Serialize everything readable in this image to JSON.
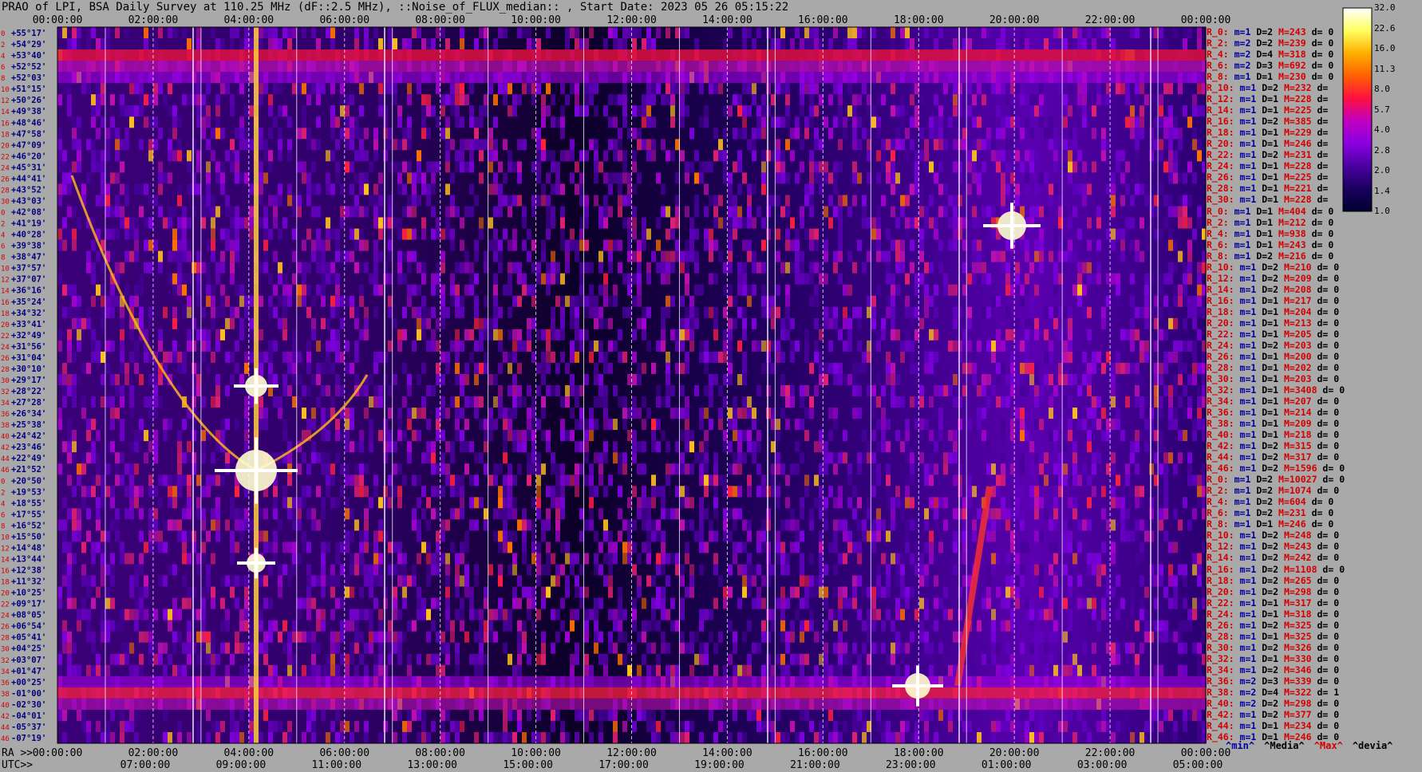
{
  "title": "PRAO of LPI, BSA Daily Survey at 110.25 MHz (dF::2.5 MHz), ::Noise_of_FLUX_median:: , Start Date: 2023 05 26 05:15:22",
  "chart_data": {
    "type": "heatmap",
    "top_ticks": [
      "00:00:00",
      "02:00:00",
      "04:00:00",
      "06:00:00",
      "08:00:00",
      "10:00:00",
      "12:00:00",
      "14:00:00",
      "16:00:00",
      "18:00:00",
      "20:00:00",
      "22:00:00",
      "00:00:00"
    ],
    "ra_prefix": "RA >>",
    "utc_prefix": "UTC>>",
    "bottom_ra_ticks": [
      "00:00:00",
      "02:00:00",
      "04:00:00",
      "06:00:00",
      "08:00:00",
      "10:00:00",
      "12:00:00",
      "14:00:00",
      "16:00:00",
      "18:00:00",
      "20:00:00",
      "22:00:00",
      "00:00:00"
    ],
    "utc_ticks": [
      "07:00:00",
      "09:00:00",
      "11:00:00",
      "13:00:00",
      "15:00:00",
      "17:00:00",
      "19:00:00",
      "21:00:00",
      "23:00:00",
      "01:00:00",
      "03:00:00",
      "05:00:00"
    ],
    "dec_labels": [
      "+55°17'",
      "+54°29'",
      "+53°40'",
      "+52°52'",
      "+52°03'",
      "+51°15'",
      "+50°26'",
      "+49°38'",
      "+48°46'",
      "+47°58'",
      "+47°09'",
      "+46°20'",
      "+45°31'",
      "+44°41'",
      "+43°52'",
      "+43°03'",
      "+42°08'",
      "+41°19'",
      "+40°28'",
      "+39°38'",
      "+38°47'",
      "+37°57'",
      "+37°07'",
      "+36°16'",
      "+35°24'",
      "+34°32'",
      "+33°41'",
      "+32°49'",
      "+31°56'",
      "+31°04'",
      "+30°10'",
      "+29°17'",
      "+28°22'",
      "+27°28'",
      "+26°34'",
      "+25°38'",
      "+24°42'",
      "+23°46'",
      "+22°49'",
      "+21°52'",
      "+20°50'",
      "+19°53'",
      "+18°55'",
      "+17°55'",
      "+16°52'",
      "+15°50'",
      "+14°48'",
      "+13°44'",
      "+12°38'",
      "+11°32'",
      "+10°25'",
      "+09°17'",
      "+08°05'",
      "+06°54'",
      "+05°41'",
      "+04°25'",
      "+03°07'",
      "+01°47'",
      "+00°25'",
      "-01°00'",
      "-02°30'",
      "-04°01'",
      "-05°37'",
      "-07°19'"
    ],
    "row_index": [
      "0",
      "2",
      "4",
      "6",
      "8",
      "10",
      "12",
      "14",
      "16",
      "18",
      "20",
      "22",
      "24",
      "26",
      "28",
      "30",
      "0",
      "2",
      "4",
      "6",
      "8",
      "10",
      "12",
      "14",
      "16",
      "18",
      "20",
      "22",
      "24",
      "26",
      "28",
      "30",
      "32",
      "34",
      "36",
      "38",
      "40",
      "42",
      "44",
      "46",
      "0",
      "2",
      "4",
      "6",
      "8",
      "10",
      "12",
      "14",
      "16",
      "18",
      "20",
      "22",
      "24",
      "26",
      "28",
      "30",
      "32",
      "34",
      "36",
      "38",
      "40",
      "42",
      "44",
      "46"
    ],
    "right_rows": [
      {
        "r": "R_0:",
        "m": "m=1",
        "D": "D=2",
        "M": "M=243",
        "d": "d= 0"
      },
      {
        "r": "R_2:",
        "m": "m=2",
        "D": "D=2",
        "M": "M=239",
        "d": "d= 0"
      },
      {
        "r": "R_4:",
        "m": "m=2",
        "D": "D=4",
        "M": "M=318",
        "d": "d= 0"
      },
      {
        "r": "R_6:",
        "m": "m=2",
        "D": "D=3",
        "M": "M=692",
        "d": "d= 0"
      },
      {
        "r": "R_8:",
        "m": "m=1",
        "D": "D=1",
        "M": "M=230",
        "d": "d= 0"
      },
      {
        "r": "R_10:",
        "m": "m=1",
        "D": "D=2",
        "M": "M=232",
        "d": "d="
      },
      {
        "r": "R_12:",
        "m": "m=1",
        "D": "D=1",
        "M": "M=228",
        "d": "d="
      },
      {
        "r": "R_14:",
        "m": "m=1",
        "D": "D=1",
        "M": "M=225",
        "d": "d="
      },
      {
        "r": "R_16:",
        "m": "m=1",
        "D": "D=2",
        "M": "M=385",
        "d": "d="
      },
      {
        "r": "R_18:",
        "m": "m=1",
        "D": "D=1",
        "M": "M=229",
        "d": "d="
      },
      {
        "r": "R_20:",
        "m": "m=1",
        "D": "D=1",
        "M": "M=246",
        "d": "d="
      },
      {
        "r": "R_22:",
        "m": "m=1",
        "D": "D=2",
        "M": "M=231",
        "d": "d="
      },
      {
        "r": "R_24:",
        "m": "m=1",
        "D": "D=1",
        "M": "M=228",
        "d": "d="
      },
      {
        "r": "R_26:",
        "m": "m=1",
        "D": "D=1",
        "M": "M=225",
        "d": "d="
      },
      {
        "r": "R_28:",
        "m": "m=1",
        "D": "D=1",
        "M": "M=221",
        "d": "d="
      },
      {
        "r": "R_30:",
        "m": "m=1",
        "D": "D=1",
        "M": "M=228",
        "d": "d="
      },
      {
        "r": "R_0:",
        "m": "m=1",
        "D": "D=1",
        "M": "M=404",
        "d": "d= 0"
      },
      {
        "r": "R_2:",
        "m": "m=1",
        "D": "D=1",
        "M": "M=212",
        "d": "d= 0"
      },
      {
        "r": "R_4:",
        "m": "m=1",
        "D": "D=1",
        "M": "M=938",
        "d": "d= 0"
      },
      {
        "r": "R_6:",
        "m": "m=1",
        "D": "D=1",
        "M": "M=243",
        "d": "d= 0"
      },
      {
        "r": "R_8:",
        "m": "m=1",
        "D": "D=2",
        "M": "M=216",
        "d": "d= 0"
      },
      {
        "r": "R_10:",
        "m": "m=1",
        "D": "D=2",
        "M": "M=210",
        "d": "d= 0"
      },
      {
        "r": "R_12:",
        "m": "m=1",
        "D": "D=2",
        "M": "M=209",
        "d": "d= 0"
      },
      {
        "r": "R_14:",
        "m": "m=1",
        "D": "D=2",
        "M": "M=208",
        "d": "d= 0"
      },
      {
        "r": "R_16:",
        "m": "m=1",
        "D": "D=1",
        "M": "M=217",
        "d": "d= 0"
      },
      {
        "r": "R_18:",
        "m": "m=1",
        "D": "D=1",
        "M": "M=204",
        "d": "d= 0"
      },
      {
        "r": "R_20:",
        "m": "m=1",
        "D": "D=1",
        "M": "M=213",
        "d": "d= 0"
      },
      {
        "r": "R_22:",
        "m": "m=1",
        "D": "D=1",
        "M": "M=205",
        "d": "d= 0"
      },
      {
        "r": "R_24:",
        "m": "m=1",
        "D": "D=2",
        "M": "M=203",
        "d": "d= 0"
      },
      {
        "r": "R_26:",
        "m": "m=1",
        "D": "D=1",
        "M": "M=200",
        "d": "d= 0"
      },
      {
        "r": "R_28:",
        "m": "m=1",
        "D": "D=1",
        "M": "M=202",
        "d": "d= 0"
      },
      {
        "r": "R_30:",
        "m": "m=1",
        "D": "D=1",
        "M": "M=203",
        "d": "d= 0"
      },
      {
        "r": "R_32:",
        "m": "m=1",
        "D": "D=1",
        "M": "M=3408",
        "d": "d= 0"
      },
      {
        "r": "R_34:",
        "m": "m=1",
        "D": "D=1",
        "M": "M=207",
        "d": "d= 0"
      },
      {
        "r": "R_36:",
        "m": "m=1",
        "D": "D=1",
        "M": "M=214",
        "d": "d= 0"
      },
      {
        "r": "R_38:",
        "m": "m=1",
        "D": "D=1",
        "M": "M=209",
        "d": "d= 0"
      },
      {
        "r": "R_40:",
        "m": "m=1",
        "D": "D=1",
        "M": "M=218",
        "d": "d= 0"
      },
      {
        "r": "R_42:",
        "m": "m=1",
        "D": "D=2",
        "M": "M=315",
        "d": "d= 0"
      },
      {
        "r": "R_44:",
        "m": "m=1",
        "D": "D=2",
        "M": "M=317",
        "d": "d= 0"
      },
      {
        "r": "R_46:",
        "m": "m=1",
        "D": "D=2",
        "M": "M=1596",
        "d": "d= 0"
      },
      {
        "r": "R_0:",
        "m": "m=1",
        "D": "D=2",
        "M": "M=10027",
        "d": "d= 0"
      },
      {
        "r": "R_2:",
        "m": "m=1",
        "D": "D=2",
        "M": "M=1074",
        "d": "d= 0"
      },
      {
        "r": "R_4:",
        "m": "m=1",
        "D": "D=2",
        "M": "M=604",
        "d": "d= 0"
      },
      {
        "r": "R_6:",
        "m": "m=1",
        "D": "D=2",
        "M": "M=231",
        "d": "d= 0"
      },
      {
        "r": "R_8:",
        "m": "m=1",
        "D": "D=1",
        "M": "M=246",
        "d": "d= 0"
      },
      {
        "r": "R_10:",
        "m": "m=1",
        "D": "D=2",
        "M": "M=248",
        "d": "d= 0"
      },
      {
        "r": "R_12:",
        "m": "m=1",
        "D": "D=2",
        "M": "M=243",
        "d": "d= 0"
      },
      {
        "r": "R_14:",
        "m": "m=1",
        "D": "D=2",
        "M": "M=242",
        "d": "d= 0"
      },
      {
        "r": "R_16:",
        "m": "m=1",
        "D": "D=2",
        "M": "M=1108",
        "d": "d= 0"
      },
      {
        "r": "R_18:",
        "m": "m=1",
        "D": "D=2",
        "M": "M=265",
        "d": "d= 0"
      },
      {
        "r": "R_20:",
        "m": "m=1",
        "D": "D=2",
        "M": "M=298",
        "d": "d= 0"
      },
      {
        "r": "R_22:",
        "m": "m=1",
        "D": "D=1",
        "M": "M=317",
        "d": "d= 0"
      },
      {
        "r": "R_24:",
        "m": "m=1",
        "D": "D=1",
        "M": "M=318",
        "d": "d= 0"
      },
      {
        "r": "R_26:",
        "m": "m=1",
        "D": "D=2",
        "M": "M=325",
        "d": "d= 0"
      },
      {
        "r": "R_28:",
        "m": "m=1",
        "D": "D=1",
        "M": "M=325",
        "d": "d= 0"
      },
      {
        "r": "R_30:",
        "m": "m=1",
        "D": "D=2",
        "M": "M=326",
        "d": "d= 0"
      },
      {
        "r": "R_32:",
        "m": "m=1",
        "D": "D=1",
        "M": "M=330",
        "d": "d= 0"
      },
      {
        "r": "R_34:",
        "m": "m=1",
        "D": "D=2",
        "M": "M=346",
        "d": "d= 0"
      },
      {
        "r": "R_36:",
        "m": "m=2",
        "D": "D=3",
        "M": "M=339",
        "d": "d= 0"
      },
      {
        "r": "R_38:",
        "m": "m=2",
        "D": "D=4",
        "M": "M=322",
        "d": "d= 1"
      },
      {
        "r": "R_40:",
        "m": "m=2",
        "D": "D=2",
        "M": "M=298",
        "d": "d= 0"
      },
      {
        "r": "R_42:",
        "m": "m=1",
        "D": "D=2",
        "M": "M=377",
        "d": "d= 0"
      },
      {
        "r": "R_44:",
        "m": "m=1",
        "D": "D=1",
        "M": "M=234",
        "d": "d= 0"
      },
      {
        "r": "R_46:",
        "m": "m=1",
        "D": "D=1",
        "M": "M=246",
        "d": "d= 0"
      }
    ],
    "colorbar": {
      "labels": [
        "32.0",
        "22.6",
        "16.0",
        "11.3",
        "8.0",
        "5.7",
        "4.0",
        "2.8",
        "2.0",
        "1.4",
        "1.0"
      ],
      "stops": [
        "#000030",
        "#1a0060",
        "#4a00a0",
        "#8a00e0",
        "#c000c0",
        "#ff1040",
        "#ff6000",
        "#ffb000",
        "#ffff60",
        "#ffffff"
      ]
    },
    "legend": [
      "^min^",
      "^Media^",
      "^Max^",
      "^devia^"
    ],
    "legend_colors": [
      "#0000a0",
      "#000000",
      "#d40000",
      "#000000"
    ]
  }
}
